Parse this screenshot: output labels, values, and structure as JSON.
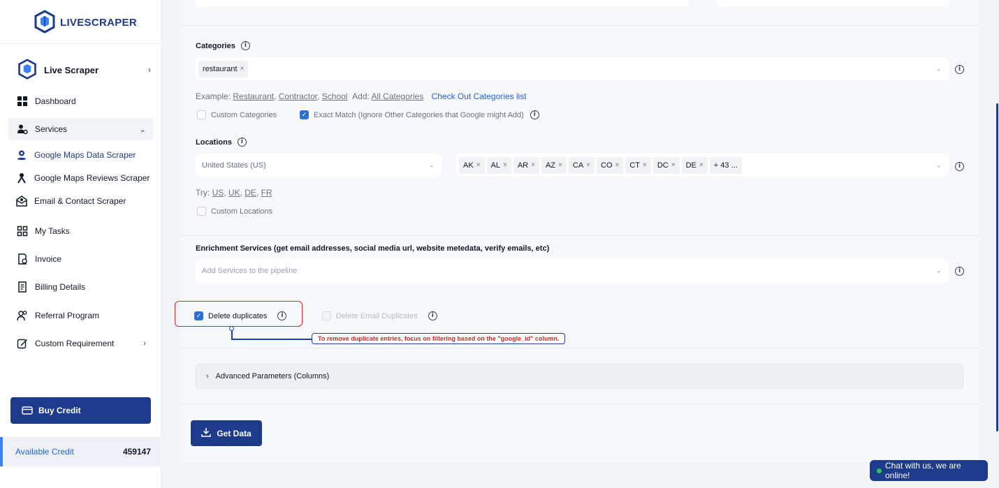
{
  "brand": {
    "name": "LIVESCRAPER"
  },
  "sidebar": {
    "product": "Live Scraper",
    "items": [
      {
        "label": "Dashboard",
        "icon": "grid-icon"
      },
      {
        "label": "Services",
        "icon": "services-icon"
      },
      {
        "label": "My Tasks",
        "icon": "tasks-icon"
      },
      {
        "label": "Invoice",
        "icon": "invoice-icon"
      },
      {
        "label": "Billing Details",
        "icon": "billing-icon"
      },
      {
        "label": "Referral Program",
        "icon": "referral-icon"
      },
      {
        "label": "Custom Requirement",
        "icon": "edit-icon"
      }
    ],
    "services_sub": [
      {
        "label": "Google Maps Data Scraper",
        "icon": "map-pin-icon"
      },
      {
        "label": "Google Maps Reviews Scraper",
        "icon": "reviews-icon"
      },
      {
        "label": "Email & Contact Scraper",
        "icon": "mail-icon"
      }
    ],
    "buy_credit": "Buy Credit",
    "available_credit_label": "Available Credit",
    "available_credit_value": "459147"
  },
  "categories": {
    "title": "Categories",
    "chips": [
      "restaurant"
    ],
    "hint_prefix": "Example:",
    "hint_examples": [
      "Restaurant",
      "Contractor",
      "School"
    ],
    "hint_add": "Add:",
    "hint_all": "All Categories",
    "hint_link": "Check Out Categories list",
    "custom_label": "Custom Categories",
    "exact_label": "Exact Match (Ignore Other Categories that Google might Add)"
  },
  "locations": {
    "title": "Locations",
    "country": "United States (US)",
    "chips": [
      "AK",
      "AL",
      "AR",
      "AZ",
      "CA",
      "CO",
      "CT",
      "DC",
      "DE"
    ],
    "more": "+ 43 ...",
    "try_prefix": "Try:",
    "try_links": [
      "US",
      "UK",
      "DE",
      "FR"
    ],
    "custom_label": "Custom Locations"
  },
  "enrichment": {
    "title": "Enrichment Services (get email addresses, social media url, website metedata, verify emails, etc)",
    "placeholder": "Add Services to the pipeline"
  },
  "duplicates": {
    "delete_label": "Delete duplicates",
    "email_label": "Delete Email Duplicates",
    "tooltip": "To remove duplicate entries, focus on filtering based on the \"google_id\" column."
  },
  "advanced": {
    "label": "Advanced Parameters (Columns)"
  },
  "get_data": "Get Data",
  "chat": "Chat with us, we are online!",
  "colors": {
    "primary": "#1e3a8a",
    "link": "#2563eb",
    "highlight": "#e02424"
  }
}
